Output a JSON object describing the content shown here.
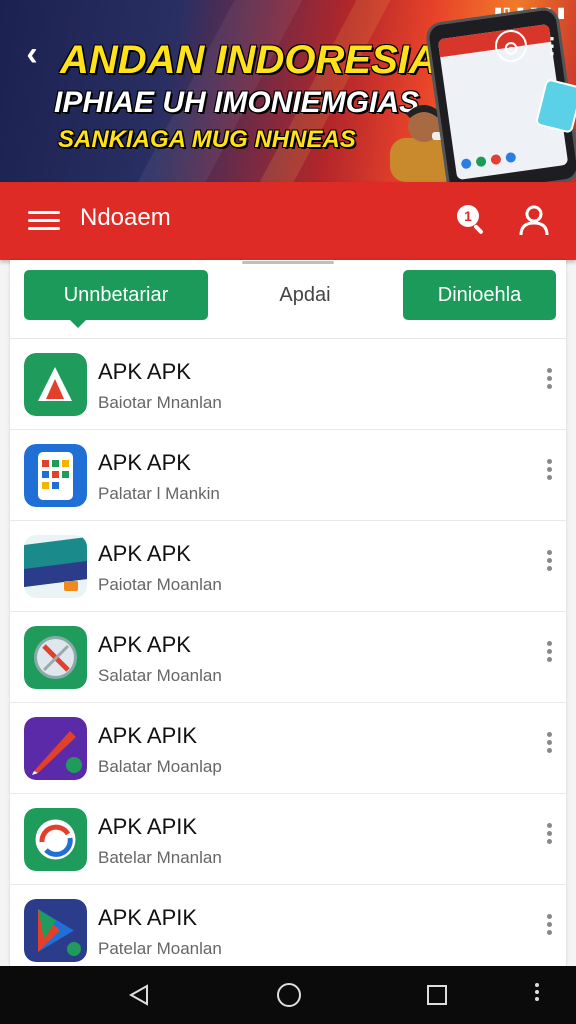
{
  "banner": {
    "line1": "ANDAN INDORESIA",
    "line2": "IPHIAE UH IMONIEMGIAS",
    "line3": "SANKIAGA MUG NHNEAS",
    "status": "▮▯ ▮ ▮ ▮ ▮"
  },
  "appbar": {
    "title": "Ndoaem"
  },
  "tabs": {
    "left": "Unnbetariar",
    "middle": "Apdai",
    "right": "Dinioehla"
  },
  "apps": [
    {
      "title": "APK APK",
      "subtitle": "Baiotar Mnanlan",
      "icon": "apk-a-icon"
    },
    {
      "title": "APK APK",
      "subtitle": "Palatar l Mankin",
      "icon": "phone-apps-icon"
    },
    {
      "title": "APK APK",
      "subtitle": "Paiotar Moanlan",
      "icon": "card-banner-icon"
    },
    {
      "title": "APK APK",
      "subtitle": "Salatar Moanlan",
      "icon": "compass-icon"
    },
    {
      "title": "APK APIK",
      "subtitle": "Balatar Moanlap",
      "icon": "pen-icon"
    },
    {
      "title": "APK APIK",
      "subtitle": "Batelar Mnanlan",
      "icon": "refresh-icon"
    },
    {
      "title": "APK APIK",
      "subtitle": "Patelar Moanlan",
      "icon": "play-store-icon"
    }
  ],
  "colors": {
    "accent": "#df2b25",
    "green": "#1c9a5a"
  }
}
